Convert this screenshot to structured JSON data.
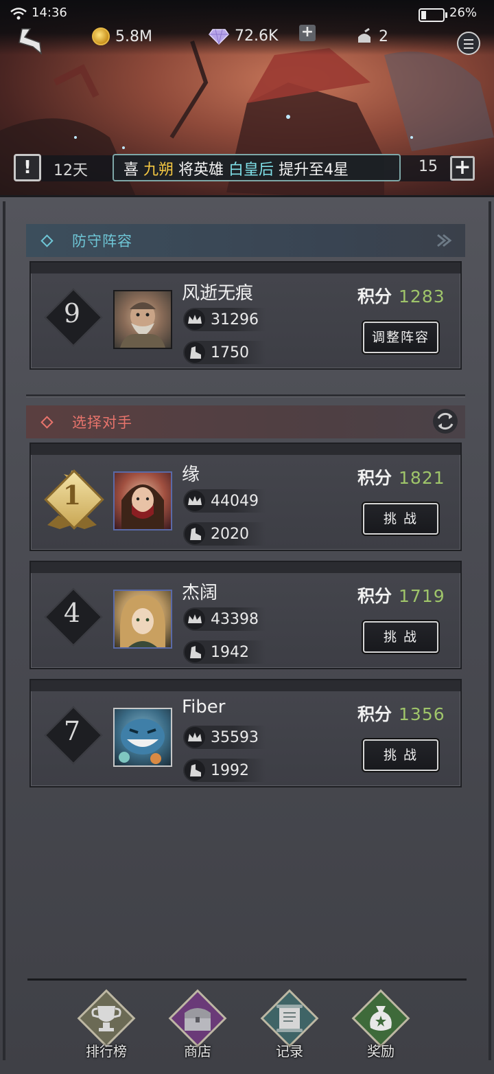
{
  "status_bar": {
    "time": "14:36",
    "battery": "26%",
    "battery_level": 0.26
  },
  "currency": {
    "gold": "5.8M",
    "gems": "72.6K",
    "tickets": "2"
  },
  "banner": {
    "days": "12天",
    "prefix": "喜",
    "player": "九朔",
    "mid": "将英雄",
    "hero": "白皇后",
    "suffix": "提升至4星",
    "count": "15"
  },
  "defense": {
    "title": "防守阵容",
    "rank": "9",
    "name": "风逝无痕",
    "crown": "31296",
    "power": "1750",
    "score_label": "积分",
    "score": "1283",
    "button": "调整阵容"
  },
  "opponents": {
    "title": "选择对手",
    "list": [
      {
        "rank": "1",
        "name": "缘",
        "crown": "44049",
        "power": "2020",
        "score_label": "积分",
        "score": "1821",
        "button": "挑 战"
      },
      {
        "rank": "4",
        "name": "杰阔",
        "crown": "43398",
        "power": "1942",
        "score_label": "积分",
        "score": "1719",
        "button": "挑 战"
      },
      {
        "rank": "7",
        "name": "Fiber",
        "crown": "35593",
        "power": "1992",
        "score_label": "积分",
        "score": "1356",
        "button": "挑 战"
      }
    ]
  },
  "nav": [
    {
      "label": "排行榜",
      "icon": "trophy-icon",
      "color": "#6b6a55"
    },
    {
      "label": "商店",
      "icon": "chest-icon",
      "color": "#6a3a78"
    },
    {
      "label": "记录",
      "icon": "scroll-icon",
      "color": "#3f6466"
    },
    {
      "label": "奖励",
      "icon": "money-bag-icon",
      "color": "#3e6a3a"
    }
  ]
}
